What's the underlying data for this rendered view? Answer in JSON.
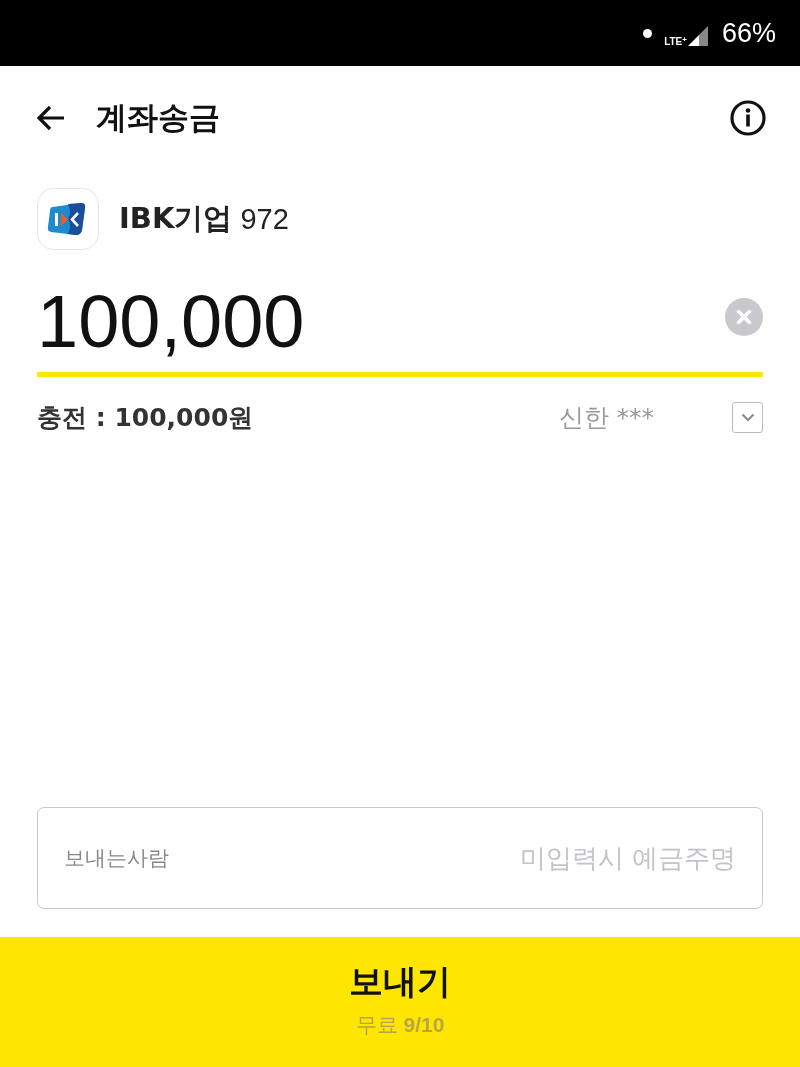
{
  "status_bar": {
    "network": "LTE$^{+}$",
    "battery": "66%"
  },
  "header": {
    "title": "계좌송금"
  },
  "account": {
    "bank": "IBK기업",
    "number": "972"
  },
  "amount": {
    "value": "100,000"
  },
  "charge": {
    "label": "충전 : 100,000원",
    "source": "신한 ***"
  },
  "sender": {
    "label": "보내는사람",
    "placeholder": "미입력시 예금주명"
  },
  "send_button": {
    "label": "보내기",
    "note": "무료 **9/10**"
  }
}
